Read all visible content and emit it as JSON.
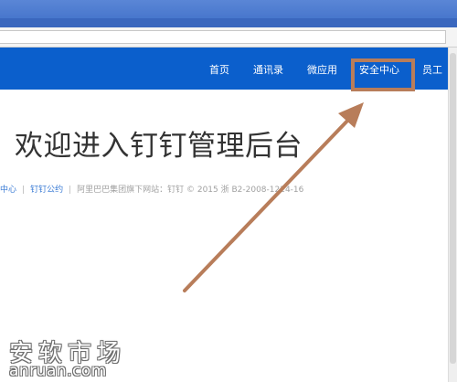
{
  "nav": {
    "items": [
      {
        "label": "首页"
      },
      {
        "label": "通讯录"
      },
      {
        "label": "微应用"
      },
      {
        "label": "安全中心"
      },
      {
        "label": "员工"
      }
    ]
  },
  "main": {
    "title": "欢迎进入钉钉管理后台"
  },
  "footer": {
    "link1": "中心",
    "sep": "|",
    "link2": "钉钉公约",
    "text": "阿里巴巴集团旗下网站：钉钉 © 2015 浙 B2-2008-1224-16"
  },
  "annotation": {
    "color": "#b87d5a"
  },
  "watermark": {
    "cn": "安软市场",
    "en": "anruan.com"
  }
}
